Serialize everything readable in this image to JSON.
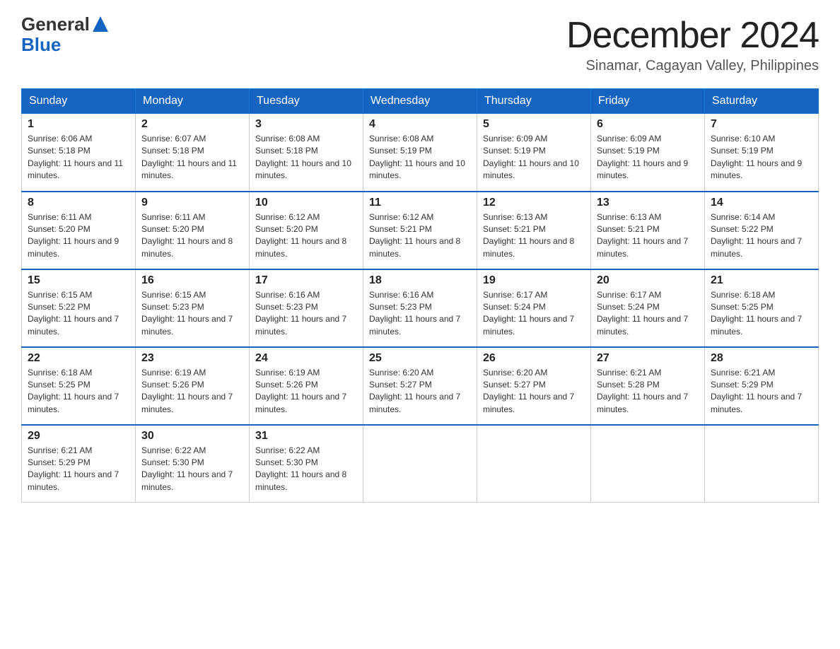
{
  "header": {
    "logo_general": "General",
    "logo_blue": "Blue",
    "title": "December 2024",
    "subtitle": "Sinamar, Cagayan Valley, Philippines"
  },
  "weekdays": [
    "Sunday",
    "Monday",
    "Tuesday",
    "Wednesday",
    "Thursday",
    "Friday",
    "Saturday"
  ],
  "weeks": [
    [
      {
        "day": "1",
        "sunrise": "6:06 AM",
        "sunset": "5:18 PM",
        "daylight": "11 hours and 11 minutes."
      },
      {
        "day": "2",
        "sunrise": "6:07 AM",
        "sunset": "5:18 PM",
        "daylight": "11 hours and 11 minutes."
      },
      {
        "day": "3",
        "sunrise": "6:08 AM",
        "sunset": "5:18 PM",
        "daylight": "11 hours and 10 minutes."
      },
      {
        "day": "4",
        "sunrise": "6:08 AM",
        "sunset": "5:19 PM",
        "daylight": "11 hours and 10 minutes."
      },
      {
        "day": "5",
        "sunrise": "6:09 AM",
        "sunset": "5:19 PM",
        "daylight": "11 hours and 10 minutes."
      },
      {
        "day": "6",
        "sunrise": "6:09 AM",
        "sunset": "5:19 PM",
        "daylight": "11 hours and 9 minutes."
      },
      {
        "day": "7",
        "sunrise": "6:10 AM",
        "sunset": "5:19 PM",
        "daylight": "11 hours and 9 minutes."
      }
    ],
    [
      {
        "day": "8",
        "sunrise": "6:11 AM",
        "sunset": "5:20 PM",
        "daylight": "11 hours and 9 minutes."
      },
      {
        "day": "9",
        "sunrise": "6:11 AM",
        "sunset": "5:20 PM",
        "daylight": "11 hours and 8 minutes."
      },
      {
        "day": "10",
        "sunrise": "6:12 AM",
        "sunset": "5:20 PM",
        "daylight": "11 hours and 8 minutes."
      },
      {
        "day": "11",
        "sunrise": "6:12 AM",
        "sunset": "5:21 PM",
        "daylight": "11 hours and 8 minutes."
      },
      {
        "day": "12",
        "sunrise": "6:13 AM",
        "sunset": "5:21 PM",
        "daylight": "11 hours and 8 minutes."
      },
      {
        "day": "13",
        "sunrise": "6:13 AM",
        "sunset": "5:21 PM",
        "daylight": "11 hours and 7 minutes."
      },
      {
        "day": "14",
        "sunrise": "6:14 AM",
        "sunset": "5:22 PM",
        "daylight": "11 hours and 7 minutes."
      }
    ],
    [
      {
        "day": "15",
        "sunrise": "6:15 AM",
        "sunset": "5:22 PM",
        "daylight": "11 hours and 7 minutes."
      },
      {
        "day": "16",
        "sunrise": "6:15 AM",
        "sunset": "5:23 PM",
        "daylight": "11 hours and 7 minutes."
      },
      {
        "day": "17",
        "sunrise": "6:16 AM",
        "sunset": "5:23 PM",
        "daylight": "11 hours and 7 minutes."
      },
      {
        "day": "18",
        "sunrise": "6:16 AM",
        "sunset": "5:23 PM",
        "daylight": "11 hours and 7 minutes."
      },
      {
        "day": "19",
        "sunrise": "6:17 AM",
        "sunset": "5:24 PM",
        "daylight": "11 hours and 7 minutes."
      },
      {
        "day": "20",
        "sunrise": "6:17 AM",
        "sunset": "5:24 PM",
        "daylight": "11 hours and 7 minutes."
      },
      {
        "day": "21",
        "sunrise": "6:18 AM",
        "sunset": "5:25 PM",
        "daylight": "11 hours and 7 minutes."
      }
    ],
    [
      {
        "day": "22",
        "sunrise": "6:18 AM",
        "sunset": "5:25 PM",
        "daylight": "11 hours and 7 minutes."
      },
      {
        "day": "23",
        "sunrise": "6:19 AM",
        "sunset": "5:26 PM",
        "daylight": "11 hours and 7 minutes."
      },
      {
        "day": "24",
        "sunrise": "6:19 AM",
        "sunset": "5:26 PM",
        "daylight": "11 hours and 7 minutes."
      },
      {
        "day": "25",
        "sunrise": "6:20 AM",
        "sunset": "5:27 PM",
        "daylight": "11 hours and 7 minutes."
      },
      {
        "day": "26",
        "sunrise": "6:20 AM",
        "sunset": "5:27 PM",
        "daylight": "11 hours and 7 minutes."
      },
      {
        "day": "27",
        "sunrise": "6:21 AM",
        "sunset": "5:28 PM",
        "daylight": "11 hours and 7 minutes."
      },
      {
        "day": "28",
        "sunrise": "6:21 AM",
        "sunset": "5:29 PM",
        "daylight": "11 hours and 7 minutes."
      }
    ],
    [
      {
        "day": "29",
        "sunrise": "6:21 AM",
        "sunset": "5:29 PM",
        "daylight": "11 hours and 7 minutes."
      },
      {
        "day": "30",
        "sunrise": "6:22 AM",
        "sunset": "5:30 PM",
        "daylight": "11 hours and 7 minutes."
      },
      {
        "day": "31",
        "sunrise": "6:22 AM",
        "sunset": "5:30 PM",
        "daylight": "11 hours and 8 minutes."
      },
      null,
      null,
      null,
      null
    ]
  ],
  "labels": {
    "sunrise_prefix": "Sunrise: ",
    "sunset_prefix": "Sunset: ",
    "daylight_prefix": "Daylight: "
  }
}
